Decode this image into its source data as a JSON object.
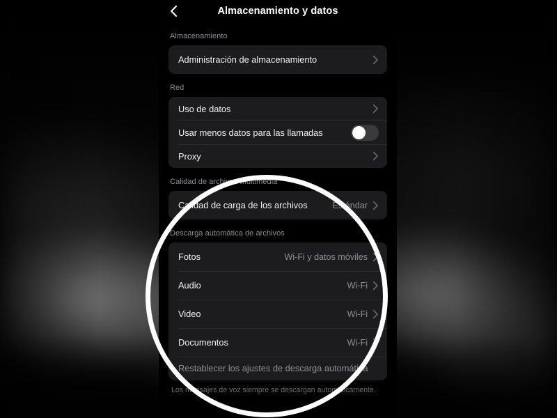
{
  "app": {
    "nav": {
      "back_icon": "chevron-left-icon",
      "title": "Almacenamiento y datos"
    }
  },
  "sections": [
    {
      "header": "Almacenamiento",
      "rows": [
        {
          "label": "Administración de almacenamiento",
          "value": "",
          "accessory": "chevron-right-icon"
        }
      ]
    },
    {
      "header": "Red",
      "rows": [
        {
          "label": "Uso de datos",
          "value": "",
          "accessory": "chevron-right-icon"
        },
        {
          "label": "Usar menos datos para las llamadas",
          "value": "",
          "accessory": "toggle-off"
        },
        {
          "label": "Proxy",
          "value": "",
          "accessory": "chevron-right-icon"
        }
      ]
    },
    {
      "header": "Calidad de archivos multimedia",
      "rows": [
        {
          "label": "Calidad de carga de los archivos",
          "value": "Estándar",
          "accessory": "chevron-right-icon"
        }
      ]
    },
    {
      "header": "Descarga automática de archivos",
      "rows": [
        {
          "label": "Fotos",
          "value": "Wi-Fi y datos móviles",
          "accessory": "chevron-right-icon"
        },
        {
          "label": "Audio",
          "value": "Wi-Fi",
          "accessory": "chevron-right-icon"
        },
        {
          "label": "Video",
          "value": "Wi-Fi",
          "accessory": "chevron-right-icon"
        },
        {
          "label": "Documentos",
          "value": "Wi-Fi",
          "accessory": "chevron-right-icon"
        },
        {
          "label": "Restablecer los ajustes de descarga automática",
          "value": "",
          "accessory": "none"
        }
      ],
      "footnote": "Los mensajes de voz siempre se descargan automáticamente."
    }
  ],
  "overlay": {
    "highlight_ring": {
      "shape": "circle",
      "color": "#ffffff"
    }
  },
  "colors": {
    "screen_background": "#000000",
    "card_background": "#1c1c1e",
    "primary_text": "#f2f2f2",
    "secondary_text": "#8e8e93",
    "separator": "#2b2b2d",
    "toggle_track_off": "#3a3a3c",
    "toggle_knob": "#ffffff",
    "ring": "#ffffff"
  }
}
